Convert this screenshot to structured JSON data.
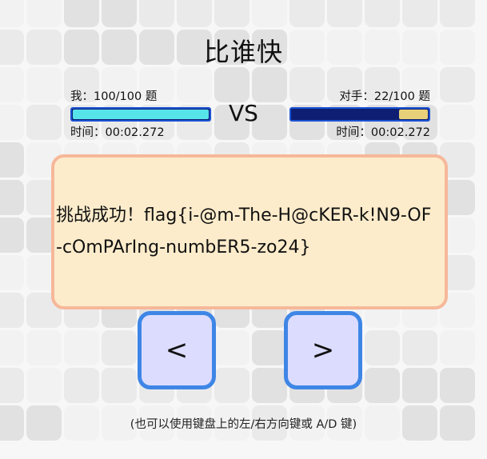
{
  "page": {
    "title": "比谁快",
    "vs": "VS"
  },
  "me": {
    "label": "我：100/100 题",
    "progress": 1.0,
    "time": "时间：00:02.272"
  },
  "opponent": {
    "label": "对手：22/100 题",
    "progress": 0.22,
    "time": "时间：00:02.272"
  },
  "result": {
    "text": "挑战成功！flag{i-@m-The-H@cKER-k!N9-OF-cOmPArIng-numbER5-zo24}"
  },
  "controls": {
    "left_label": "<",
    "right_label": ">",
    "hint": "(也可以使用键盘上的左/右方向键或 A/D 键)"
  },
  "colors": {
    "result_bg": "#fdeccb",
    "result_border": "#f6b89a",
    "button_bg": "#dcdcff",
    "button_border": "#3e86e6",
    "bar_bg": "#0e1f73",
    "bar_border": "#1b53d2",
    "me_fill": "#56e3ea",
    "opponent_fill": "#e8d07a"
  }
}
